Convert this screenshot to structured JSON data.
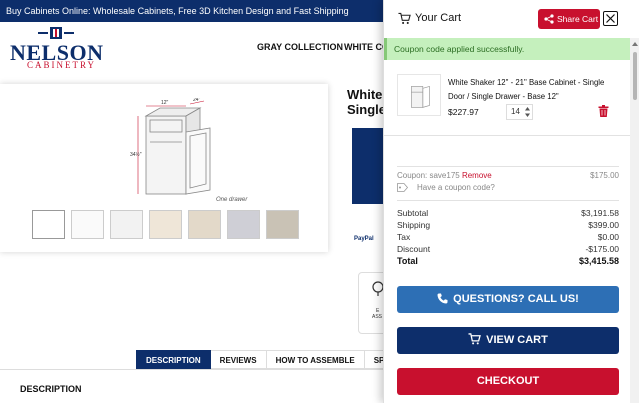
{
  "promo": {
    "text": "Buy Cabinets Online: Wholesale Cabinets, Free 3D Kitchen Design and Fast Shipping"
  },
  "brand": {
    "name": "NELSON",
    "tagline": "CABINETRY"
  },
  "nav": {
    "items": [
      "GRAY COLLECTION",
      "WHITE CO"
    ]
  },
  "product": {
    "title_line1": "White S",
    "title_line2": "Single",
    "image_caption": "One drawer",
    "paypal": "PayPal",
    "assist_label_1": "E",
    "assist_label_2": "ASS"
  },
  "tabs": [
    "DESCRIPTION",
    "REVIEWS",
    "HOW TO ASSEMBLE",
    "SPECIFICATI"
  ],
  "description_heading": "DESCRIPTION",
  "cart": {
    "title": "Your Cart",
    "share_label": "Share Cart",
    "alert": "Coupon code applied successfully.",
    "item": {
      "name": "White Shaker 12\" - 21\" Base Cabinet - Single Door / Single Drawer - Base 12\"",
      "price": "$227.97",
      "qty": "14"
    },
    "coupon": {
      "label": "Coupon: save175",
      "remove": "Remove",
      "amount": "$175.00",
      "prompt": "Have a coupon code?"
    },
    "totals": [
      {
        "label": "Subtotal",
        "value": "$3,191.58"
      },
      {
        "label": "Shipping",
        "value": "$399.00"
      },
      {
        "label": "Tax",
        "value": "$0.00"
      },
      {
        "label": "Discount",
        "value": "-$175.00"
      }
    ],
    "total": {
      "label": "Total",
      "value": "$3,415.58"
    },
    "buttons": {
      "call": "QUESTIONS? CALL US!",
      "view": "VIEW CART",
      "checkout": "CHECKOUT"
    }
  },
  "colors": {
    "navy": "#0d2e6b",
    "red": "#c8102e",
    "blue": "#2d6fb5",
    "success_bg": "#c5f0bd"
  }
}
